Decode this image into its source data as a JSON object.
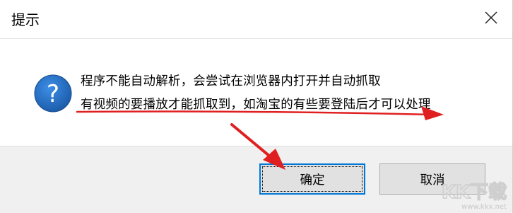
{
  "dialog": {
    "title": "提示",
    "close_icon": "close-icon"
  },
  "message": {
    "icon": "question-icon",
    "line1": "程序不能自动解析，会尝试在浏览器内打开并自动抓取",
    "line2": "有视频的要播放才能抓取到，如淘宝的有些要登陆后才可以处理"
  },
  "buttons": {
    "ok_label": "确定",
    "cancel_label": "取消"
  },
  "colors": {
    "accent": "#0078d7",
    "annotation": "#e02020",
    "icon_blue": "#1f66b8"
  },
  "watermark": {
    "logo_text": "KK下载",
    "url": "www.kkx.net"
  }
}
